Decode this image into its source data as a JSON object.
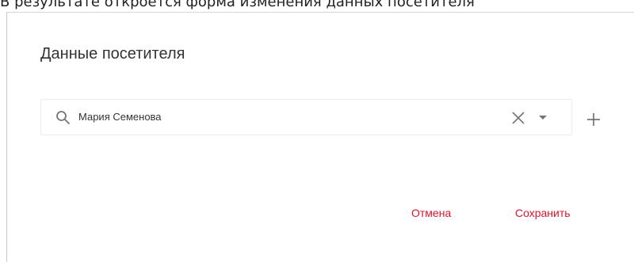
{
  "caption": "В результате откроется форма изменения данных посетителя",
  "dialog": {
    "title": "Данные посетителя",
    "search": {
      "value": "Мария Семенова",
      "icon": "search-icon"
    },
    "icons": {
      "clear": "close-icon",
      "dropdown": "chevron-down-icon",
      "add": "plus-icon"
    },
    "buttons": {
      "cancel": "Отмена",
      "save": "Сохранить"
    },
    "colors": {
      "accent": "#e2122f",
      "text": "#333333",
      "border": "#ececec",
      "icon": "#757575"
    }
  }
}
